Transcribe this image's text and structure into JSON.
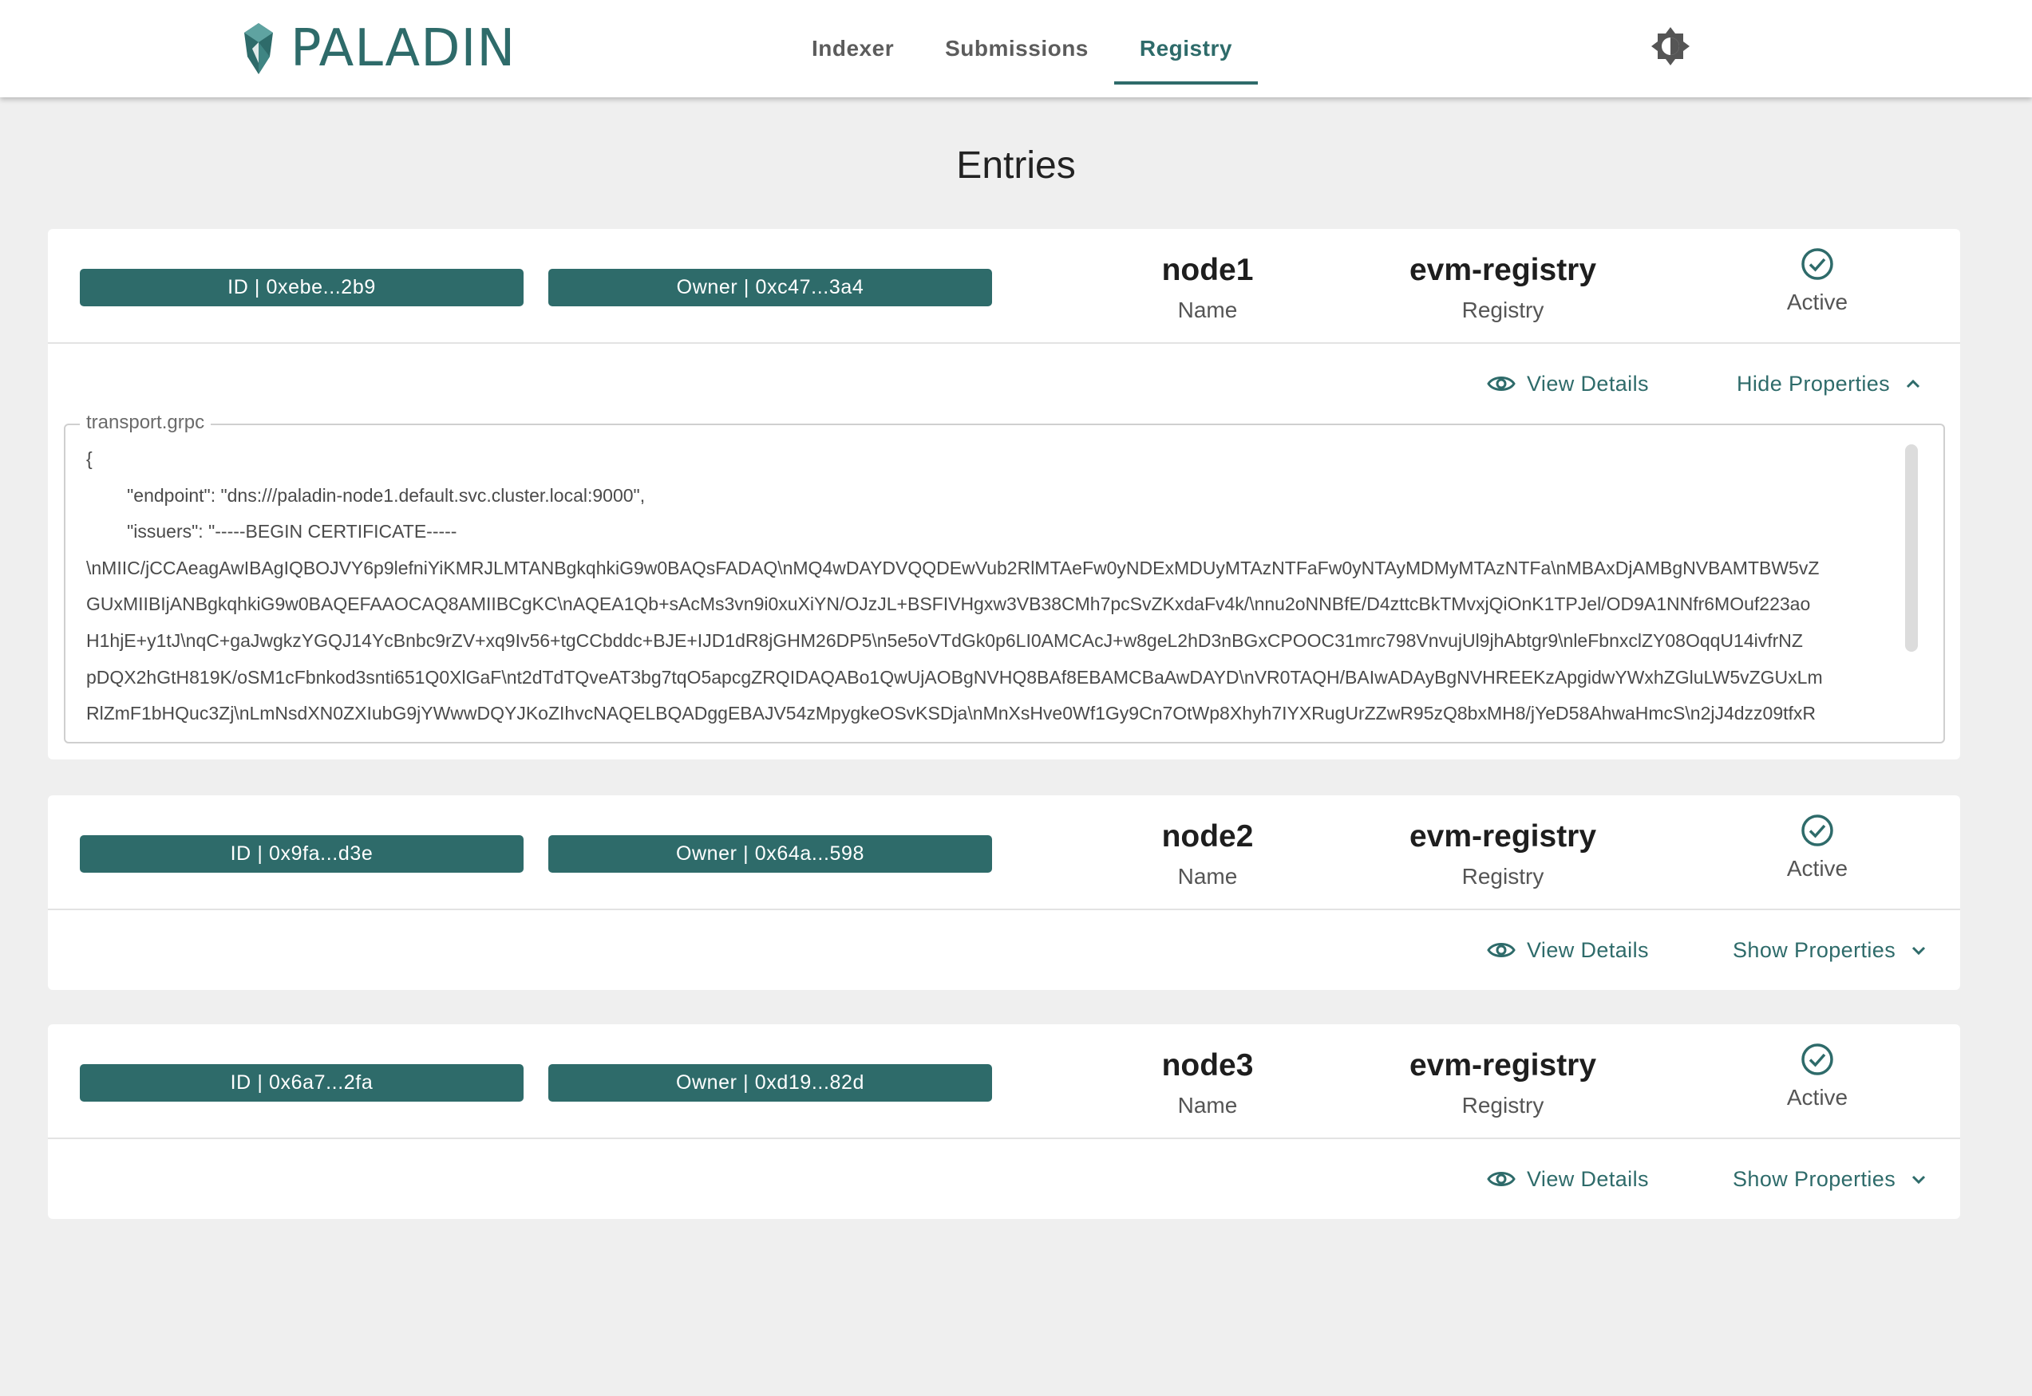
{
  "app": {
    "brand": "PALADIN",
    "nav": [
      "Indexer",
      "Submissions",
      "Registry"
    ],
    "active_tab": "Registry",
    "theme_icon": "brightness-icon",
    "accent_color": "#2e6b6a"
  },
  "page": {
    "title": "Entries"
  },
  "entries": [
    {
      "id": "ID | 0xebe...2b9",
      "owner": "Owner | 0xc47...3a4",
      "name": "node1",
      "name_label": "Name",
      "registry": "evm-registry",
      "registry_label": "Registry",
      "status": "Active",
      "view_details": "View Details",
      "properties_toggle": "Hide Properties",
      "expanded": true,
      "property_name": "transport.grpc",
      "property_lines": [
        "{",
        "        \"endpoint\": \"dns:///paladin-node1.default.svc.cluster.local:9000\",",
        "        \"issuers\": \"-----BEGIN CERTIFICATE-----",
        "\\nMIIC/jCCAeagAwIBAgIQBOJVY6p9lefniYiKMRJLMTANBgkqhkiG9w0BAQsFADAQ\\nMQ4wDAYDVQQDEwVub2RlMTAeFw0yNDExMDUyMTAzNTFaFw0yNTAyMDMyMTAzNTFa\\nMBAxDjAMBgNVBAMTBW5vZ",
        "GUxMIIBIjANBgkqhkiG9w0BAQEFAAOCAQ8AMIIBCgKC\\nAQEA1Qb+sAcMs3vn9i0xuXiYN/OJzJL+BSFIVHgxw3VB38CMh7pcSvZKxdaFv4k/\\nnu2oNNBfE/D4zttcBkTMvxjQiOnK1TPJel/OD9A1NNfr6MOuf223ao",
        "H1hjE+y1tJ\\nqC+gaJwgkzYGQJ14YcBnbc9rZV+xq9Iv56+tgCCbddc+BJE+IJD1dR8jGHM26DP5\\n5e5oVTdGk0p6LI0AMCAcJ+w8geL2hD3nBGxCPOOC31mrc798VnvujUl9jhAbtgr9\\nleFbnxclZY08OqqU14ivfrNZ",
        "pDQX2hGtH819K/oSM1cFbnkod3snti651Q0XlGaF\\nt2dTdTQveAT3bg7tqO5apcgZRQIDAQABo1QwUjAOBgNVHQ8BAf8EBAMCBaAwDAYD\\nVR0TAQH/BAIwADAyBgNVHREEKzApgidwYWxhZGluLW5vZGUxLm",
        "RlZmF1bHQuc3Zj\\nLmNsdXN0ZXIubG9jYWwwDQYJKoZIhvcNAQELBQADggEBAJV54zMpygkeOSvKSDja\\nMnXsHve0Wf1Gy9Cn7OtWp8Xhyh7IYXRugUrZZwR95zQ8bxMH8/jYeD58AhwaHmcS\\n2jJ4dzz09tfxR"
      ]
    },
    {
      "id": "ID | 0x9fa...d3e",
      "owner": "Owner | 0x64a...598",
      "name": "node2",
      "name_label": "Name",
      "registry": "evm-registry",
      "registry_label": "Registry",
      "status": "Active",
      "view_details": "View Details",
      "properties_toggle": "Show Properties",
      "expanded": false
    },
    {
      "id": "ID | 0x6a7...2fa",
      "owner": "Owner | 0xd19...82d",
      "name": "node3",
      "name_label": "Name",
      "registry": "evm-registry",
      "registry_label": "Registry",
      "status": "Active",
      "view_details": "View Details",
      "properties_toggle": "Show Properties",
      "expanded": false
    }
  ]
}
